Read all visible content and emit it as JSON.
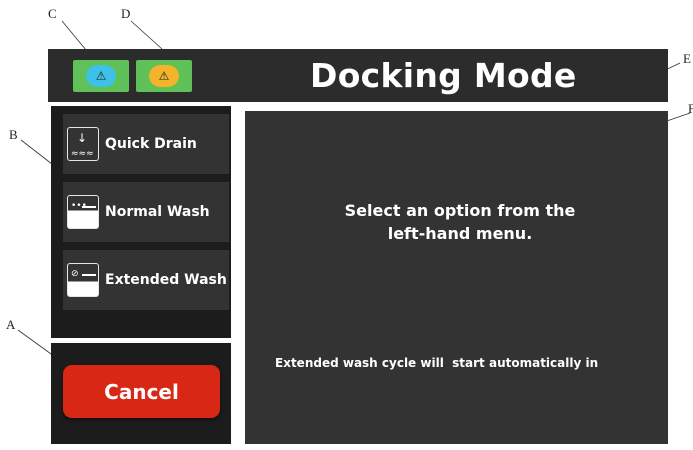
{
  "callouts": {
    "a": "A",
    "b": "B",
    "c": "C",
    "d": "D",
    "e": "E",
    "f": "F"
  },
  "header": {
    "title": "Docking Mode",
    "warnings": [
      {
        "icon": "warning-icon",
        "color": "#3ec1e6"
      },
      {
        "icon": "warning-hand-icon",
        "color": "#f3b32a"
      }
    ]
  },
  "sidebar": {
    "items": [
      {
        "label": "Quick Drain",
        "icon": "drain-icon"
      },
      {
        "label": "Normal Wash",
        "icon": "normal-wash-icon"
      },
      {
        "label": "Extended Wash",
        "icon": "extended-wash-icon"
      }
    ]
  },
  "cancel": {
    "label": "Cancel",
    "color": "#d92716"
  },
  "content": {
    "prompt": "Select an option from the\nleft-hand menu.",
    "status": "Extended wash cycle will  start automatically in"
  },
  "colors": {
    "header_bg": "#2c2c2c",
    "panel_bg": "#333333",
    "accent_green": "#5fc157"
  }
}
